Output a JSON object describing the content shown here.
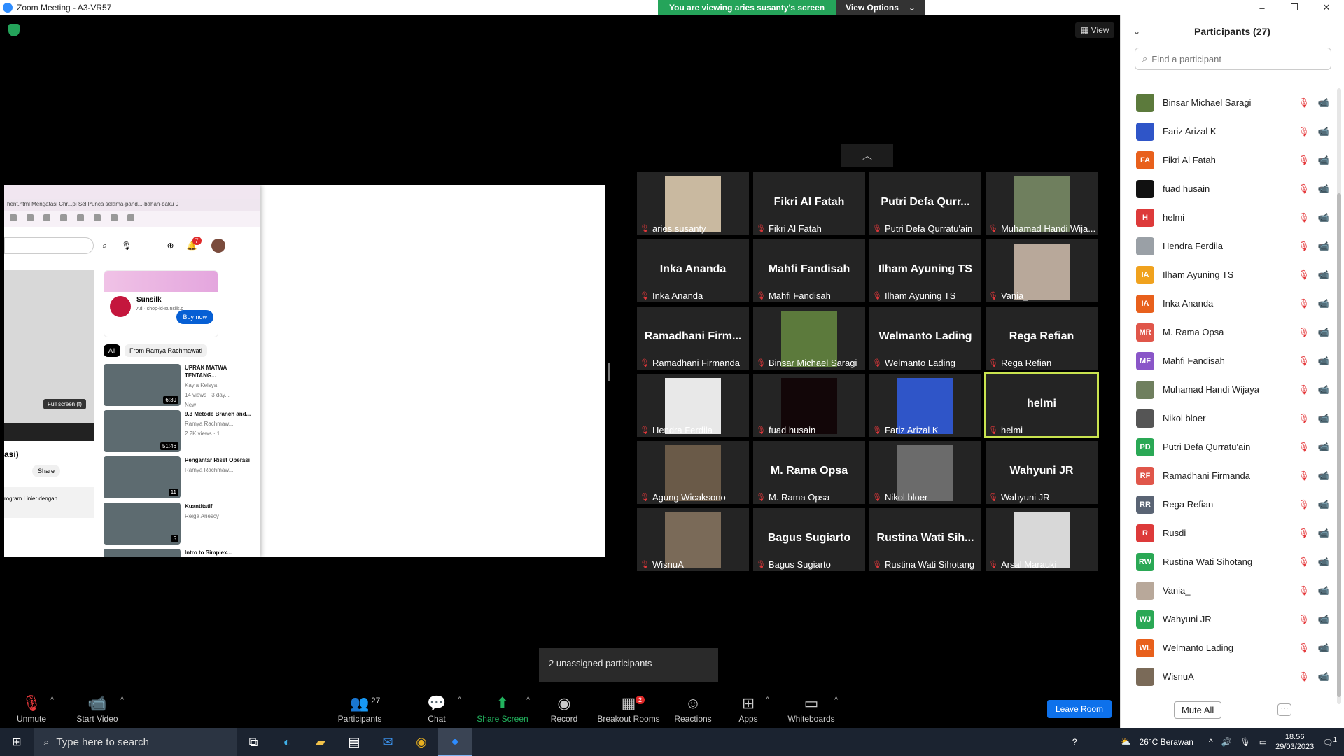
{
  "window": {
    "title": "Zoom Meeting - A3-VR57",
    "minimize": "–",
    "restore": "❐",
    "close": "✕"
  },
  "banner": {
    "viewing": "You are viewing aries susanty's screen",
    "view_options": "View Options",
    "caret": "⌄"
  },
  "view_button": "View",
  "shared_screen": {
    "tabs": "hent.html   Mengatasi Chr...pi Sel Punca   selama-pand...-bahan-baku   0",
    "video_tooltip": "Full screen (f)",
    "title_fragment": "asi)",
    "share_label": "Share",
    "desc_fragment": "rogram Linier dengan",
    "notif_count": "7",
    "ad": {
      "brand": "Sunsilk",
      "sub": "Ad · shop-id-sunsilk.c",
      "cta": "Buy now"
    },
    "chips": [
      "All",
      "From Ramya Rachmawati"
    ],
    "recs": [
      {
        "title": "UPRAK MATWA TENTANG...",
        "meta": "Kayla Keisya",
        "meta2": "14 views · 3 day...",
        "badge": "New",
        "dur": "6:39"
      },
      {
        "title": "9.3 Metode Branch and...",
        "meta": "Ramya Rachmaw...",
        "meta2": "2.2K views · 1...",
        "badge": "",
        "dur": "51:46"
      },
      {
        "title": "Pengantar Riset Operasi",
        "meta": "Ramya Rachmaw...",
        "meta2": "",
        "badge": "",
        "dur": "11"
      },
      {
        "title": "Kuantitatif",
        "meta": "Reiga Ariescy",
        "meta2": "",
        "badge": "",
        "dur": "5"
      },
      {
        "title": "Intro to Simplex...",
        "meta": "",
        "meta2": "",
        "badge": "",
        "dur": ""
      }
    ]
  },
  "grid": [
    {
      "big": "",
      "label": "aries susanty",
      "photo": true,
      "color": "#c9b9a0"
    },
    {
      "big": "Fikri Al Fatah",
      "label": "Fikri Al Fatah",
      "photo": false
    },
    {
      "big": "Putri  Defa  Qurr...",
      "label": "Putri Defa Qurratu'ain",
      "photo": false
    },
    {
      "big": "",
      "label": "Muhamad Handi Wija...",
      "photo": true,
      "color": "#6f7f5e"
    },
    {
      "big": "Inka Ananda",
      "label": "Inka Ananda",
      "photo": false
    },
    {
      "big": "Mahfi Fandisah",
      "label": "Mahfi Fandisah",
      "photo": false
    },
    {
      "big": "Ilham Ayuning TS",
      "label": "Ilham Ayuning TS",
      "photo": false
    },
    {
      "big": "",
      "label": "Vania_",
      "photo": true,
      "color": "#b8a89a"
    },
    {
      "big": "Ramadhani  Firm...",
      "label": "Ramadhani Firmanda",
      "photo": false
    },
    {
      "big": "",
      "label": "Binsar Michael Saragi",
      "photo": true,
      "color": "#5c7a3c"
    },
    {
      "big": "Welmanto Lading",
      "label": "Welmanto Lading",
      "photo": false
    },
    {
      "big": "Rega Refian",
      "label": "Rega Refian",
      "photo": false
    },
    {
      "big": "",
      "label": "Hendra Ferdila",
      "photo": true,
      "color": "#e8e8e8"
    },
    {
      "big": "",
      "label": "fuad husain",
      "photo": true,
      "color": "#120608"
    },
    {
      "big": "",
      "label": "Fariz Arizal K",
      "photo": true,
      "color": "#2f55c8"
    },
    {
      "big": "helmi",
      "label": "helmi",
      "photo": false,
      "active": true
    },
    {
      "big": "",
      "label": "Agung Wicaksono",
      "photo": true,
      "color": "#6a5a48"
    },
    {
      "big": "M. Rama Opsa",
      "label": "M. Rama Opsa",
      "photo": false
    },
    {
      "big": "",
      "label": "Nikol bloer",
      "photo": true,
      "color": "#6b6b6b"
    },
    {
      "big": "Wahyuni JR",
      "label": "Wahyuni JR",
      "photo": false
    },
    {
      "big": "",
      "label": "WisnuA",
      "photo": true,
      "color": "#7a6a58"
    },
    {
      "big": "Bagus Sugiarto",
      "label": "Bagus Sugiarto",
      "photo": false
    },
    {
      "big": "Rustina  Wati  Sih...",
      "label": "Rustina Wati Sihotang",
      "photo": false
    },
    {
      "big": "",
      "label": "Arsal Marauki",
      "photo": true,
      "color": "#d8d8d8"
    }
  ],
  "popup": "2 unassigned participants",
  "toolbar": {
    "unmute": "Unmute",
    "start_video": "Start Video",
    "participants": "Participants",
    "participants_count": "27",
    "chat": "Chat",
    "share_screen": "Share Screen",
    "record": "Record",
    "breakout": "Breakout Rooms",
    "breakout_badge": "2",
    "reactions": "Reactions",
    "apps": "Apps",
    "whiteboards": "Whiteboards",
    "leave": "Leave Room"
  },
  "panel": {
    "title": "Participants (27)",
    "search_placeholder": "Find a participant",
    "participants": [
      {
        "name": "Binsar Michael Saragi",
        "initials": "",
        "color": "#5c7a3c"
      },
      {
        "name": "Fariz Arizal K",
        "initials": "",
        "color": "#2f55c8"
      },
      {
        "name": "Fikri Al Fatah",
        "initials": "FA",
        "color": "#e8601c"
      },
      {
        "name": "fuad husain",
        "initials": "",
        "color": "#111111"
      },
      {
        "name": "helmi",
        "initials": "H",
        "color": "#dd3a3a"
      },
      {
        "name": "Hendra Ferdila",
        "initials": "",
        "color": "#9aa0a6"
      },
      {
        "name": "Ilham Ayuning TS",
        "initials": "IA",
        "color": "#f0a21e"
      },
      {
        "name": "Inka Ananda",
        "initials": "IA",
        "color": "#e8601c"
      },
      {
        "name": "M. Rama Opsa",
        "initials": "MR",
        "color": "#e0564a"
      },
      {
        "name": "Mahfi Fandisah",
        "initials": "MF",
        "color": "#8a56c8"
      },
      {
        "name": "Muhamad Handi Wijaya",
        "initials": "",
        "color": "#6f7f5e"
      },
      {
        "name": "Nikol bloer",
        "initials": "",
        "color": "#555555"
      },
      {
        "name": "Putri Defa Qurratu'ain",
        "initials": "PD",
        "color": "#2aa855"
      },
      {
        "name": "Ramadhani Firmanda",
        "initials": "RF",
        "color": "#e0564a"
      },
      {
        "name": "Rega Refian",
        "initials": "RR",
        "color": "#5a6474"
      },
      {
        "name": "Rusdi",
        "initials": "R",
        "color": "#dd3a3a"
      },
      {
        "name": "Rustina Wati Sihotang",
        "initials": "RW",
        "color": "#2aa855"
      },
      {
        "name": "Vania_",
        "initials": "",
        "color": "#b8a89a"
      },
      {
        "name": "Wahyuni JR",
        "initials": "WJ",
        "color": "#2aa855"
      },
      {
        "name": "Welmanto Lading",
        "initials": "WL",
        "color": "#e8601c"
      },
      {
        "name": "WisnuA",
        "initials": "",
        "color": "#7a6a58"
      }
    ],
    "mute_all": "Mute All",
    "more": "···"
  },
  "taskbar": {
    "search": "Type here to search",
    "weather": "26°C  Berawan",
    "time": "18.56",
    "date": "29/03/2023",
    "notif": "1"
  }
}
